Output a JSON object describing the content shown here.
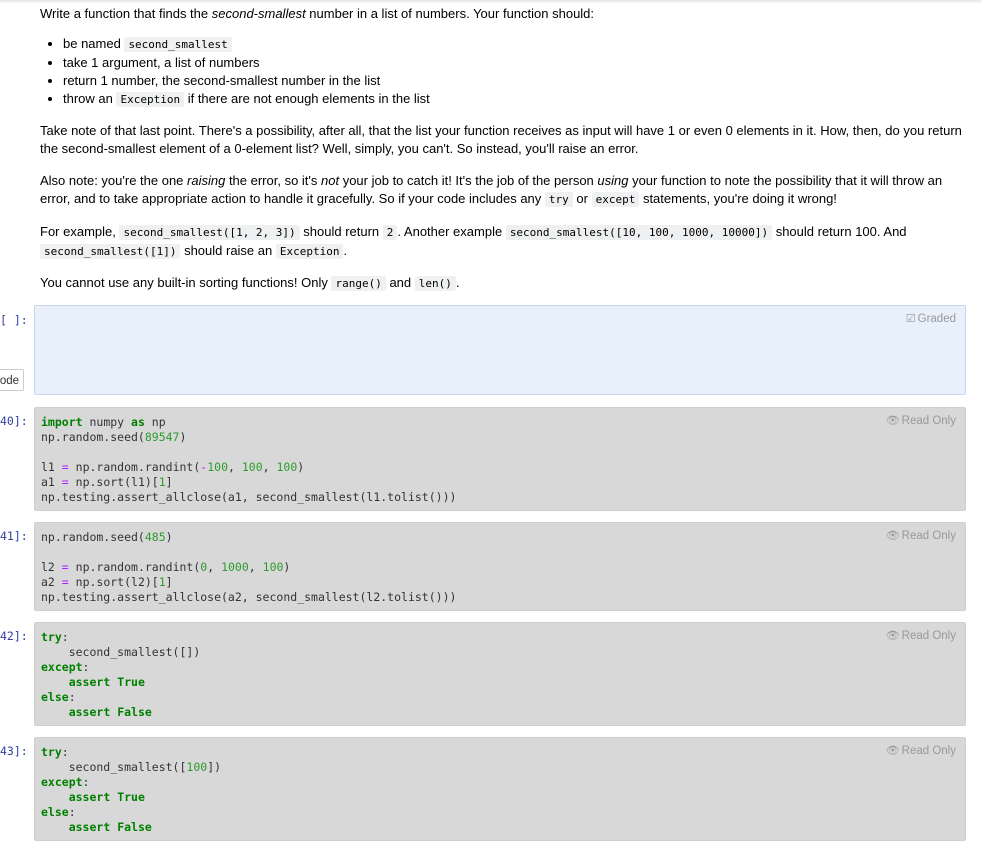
{
  "instructions": {
    "intro_before": "Write a function that finds the ",
    "intro_em": "second-smallest",
    "intro_after": " number in a list of numbers. Your function should:",
    "bullets": [
      {
        "pre": "be named ",
        "code": "second_smallest",
        "post": ""
      },
      {
        "pre": "take 1 argument, a list of numbers",
        "code": "",
        "post": ""
      },
      {
        "pre": "return 1 number, the second-smallest number in the list",
        "code": "",
        "post": ""
      },
      {
        "pre": "throw an ",
        "code": "Exception",
        "post": " if there are not enough elements in the list"
      }
    ],
    "p2": "Take note of that last point. There's a possibility, after all, that the list your function receives as input will have 1 or even 0 elements in it. How, then, do you return the second-smallest element of a 0-element list? Well, simply, you can't. So instead, you'll raise an error.",
    "p3": {
      "a": "Also note: you're the one ",
      "em1": "raising",
      "b": " the error, so it's ",
      "em2": "not",
      "c": " your job to catch it! It's the job of the person ",
      "em3": "using",
      "d": " your function to note the possibility that it will throw an error, and to take appropriate action to handle it gracefully. So if your code includes any ",
      "code1": "try",
      "e": " or ",
      "code2": "except",
      "f": " statements, you're doing it wrong!"
    },
    "p4": {
      "a": "For example, ",
      "code1": "second_smallest([1, 2, 3])",
      "b": " should return ",
      "code2": "2",
      "c": ". Another example ",
      "code3": "second_smallest([10, 100, 1000, 10000])",
      "d": " should return 100. And ",
      "code4": "second_smallest([1])",
      "e": " should raise an ",
      "code5": "Exception",
      "f": "."
    },
    "p5": {
      "a": "You cannot use any built-in sorting functions! Only ",
      "code1": "range()",
      "b": " and ",
      "code2": "len()",
      "c": "."
    }
  },
  "cells": [
    {
      "prompt": "[ ]:",
      "badge": "Graded",
      "badge_icon": "checkbox-icon"
    },
    {
      "prompt": "40]:",
      "badge": "Read Only",
      "badge_icon": "eye-icon"
    },
    {
      "prompt": "41]:",
      "badge": "Read Only",
      "badge_icon": "eye-icon"
    },
    {
      "prompt": "42]:",
      "badge": "Read Only",
      "badge_icon": "eye-icon"
    },
    {
      "prompt": "43]:",
      "badge": "Read Only",
      "badge_icon": "eye-icon"
    }
  ],
  "mode_button": "ode",
  "code": {
    "c40": [
      "import numpy as np",
      "np.random.seed(89547)",
      "",
      "l1 = np.random.randint(-100, 100, 100)",
      "a1 = np.sort(l1)[1]",
      "np.testing.assert_allclose(a1, second_smallest(l1.tolist()))"
    ],
    "c41": [
      "np.random.seed(485)",
      "",
      "l2 = np.random.randint(0, 1000, 100)",
      "a2 = np.sort(l2)[1]",
      "np.testing.assert_allclose(a2, second_smallest(l2.tolist()))"
    ],
    "c42": [
      "try:",
      "    second_smallest([])",
      "except:",
      "    assert True",
      "else:",
      "    assert False"
    ],
    "c43": [
      "try:",
      "    second_smallest([100])",
      "except:",
      "    assert True",
      "else:",
      "    assert False"
    ]
  }
}
